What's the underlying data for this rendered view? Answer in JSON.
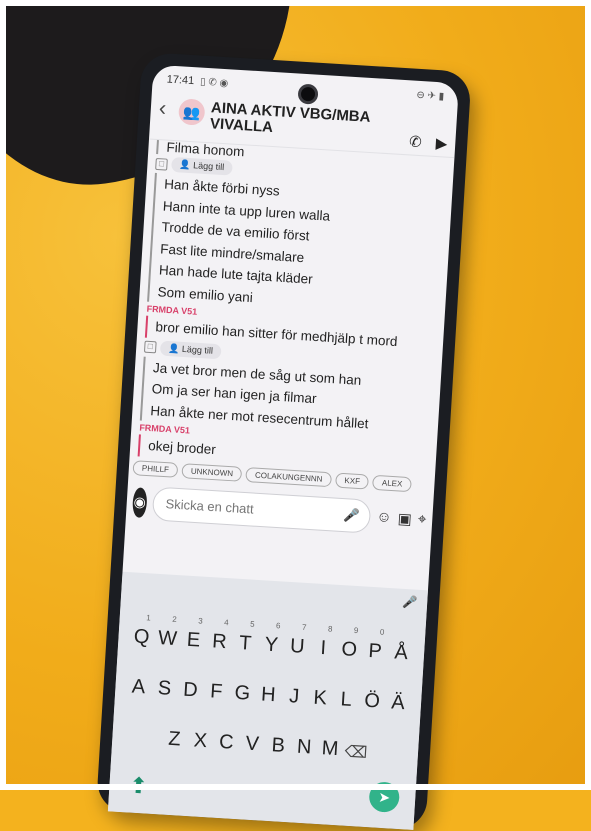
{
  "status": {
    "time": "17:41"
  },
  "header": {
    "title": "AINA AKTIV VBG/MBA VIVALLA"
  },
  "messages_top": [
    "Filma honom"
  ],
  "add_label": "Lägg till",
  "group1": [
    "Han åkte förbi nyss",
    "Hann inte ta upp luren walla",
    "Trodde de va emilio först",
    "Fast lite mindre/smalare",
    "Han hade lute tajta kläder",
    "Som emilio yani"
  ],
  "sender": "FRMDA V51",
  "group2": [
    "bror emilio han sitter för medhjälp t mord"
  ],
  "group3": [
    "Ja vet bror men de såg ut som han",
    "Om ja ser han igen ja filmar",
    "Han åkte ner mot resecentrum hållet"
  ],
  "group4": [
    "okej broder"
  ],
  "chips": [
    "PHILLF",
    "UNKNOWN",
    "COLAKUNGENNN",
    "KXF",
    "ALEX"
  ],
  "input": {
    "placeholder": "Skicka en chatt"
  },
  "keyboard": {
    "row1": [
      "Q",
      "W",
      "E",
      "R",
      "T",
      "Y",
      "U",
      "I",
      "O",
      "P",
      "Å"
    ],
    "row1_nums": [
      "1",
      "2",
      "3",
      "4",
      "5",
      "6",
      "7",
      "8",
      "9",
      "0",
      ""
    ],
    "row2": [
      "A",
      "S",
      "D",
      "F",
      "G",
      "H",
      "J",
      "K",
      "L",
      "Ö",
      "Ä"
    ],
    "row3": [
      "Z",
      "X",
      "C",
      "V",
      "B",
      "N",
      "M"
    ]
  }
}
